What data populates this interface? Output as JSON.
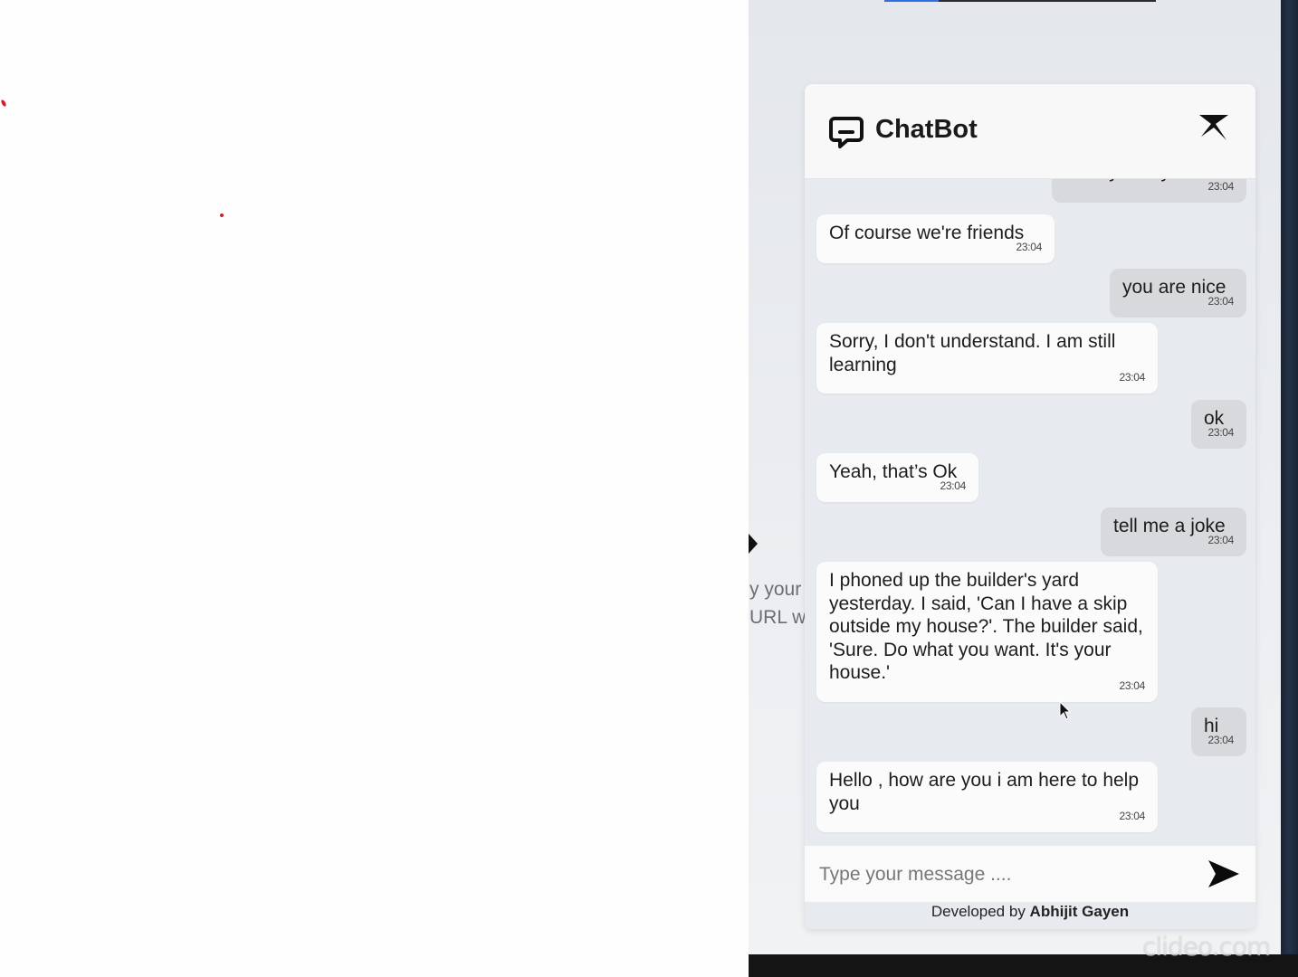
{
  "chat": {
    "title": "ChatBot",
    "messages": [
      {
        "sender": "user",
        "text": "are you my friend?",
        "time": "23:04"
      },
      {
        "sender": "bot",
        "text": "Of course we're friends",
        "time": "23:04"
      },
      {
        "sender": "user",
        "text": "you are nice",
        "time": "23:04"
      },
      {
        "sender": "bot",
        "text": "Sorry, I don't understand. I am still learning",
        "time": "23:04"
      },
      {
        "sender": "user",
        "text": "ok",
        "time": "23:04"
      },
      {
        "sender": "bot",
        "text": "Yeah, that’s Ok",
        "time": "23:04"
      },
      {
        "sender": "user",
        "text": "tell me a joke",
        "time": "23:04"
      },
      {
        "sender": "bot",
        "text": "I phoned up the builder's yard yesterday. I said, 'Can I have a skip outside my house?'. The builder said, 'Sure. Do what you want. It's your house.'",
        "time": "23:04"
      },
      {
        "sender": "user",
        "text": "hi",
        "time": "23:04"
      },
      {
        "sender": "bot",
        "text": "Hello , how are you i am here to help you",
        "time": "23:04"
      }
    ],
    "input_placeholder": "Type your message ....",
    "footer_prefix": "Developed by",
    "footer_author": "Abhijit Gayen"
  },
  "background": {
    "text_line1": "y your",
    "text_line2": "URL w"
  },
  "watermark": "clideo.com",
  "colors": {
    "user_bubble": "#d8d9dc",
    "bot_bubble": "#fbfbfb",
    "widget_bg": "#e7eaee",
    "speck": "#d0202a"
  },
  "icons": {
    "header": "chat-bubble-icon",
    "close": "close-icon",
    "send": "send-arrow-icon"
  }
}
